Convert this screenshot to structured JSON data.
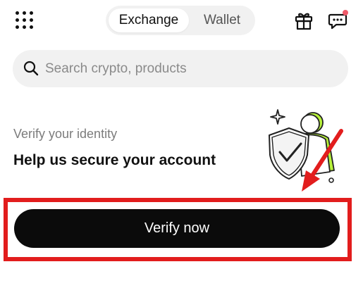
{
  "header": {
    "tabs": [
      {
        "label": "Exchange",
        "active": true
      },
      {
        "label": "Wallet",
        "active": false
      }
    ],
    "icons": {
      "menu": "grid-menu-icon",
      "gift": "gift-icon",
      "chat": "chat-icon"
    },
    "notification_dot_color": "#f05b6a"
  },
  "search": {
    "placeholder": "Search crypto, products",
    "value": ""
  },
  "verify_card": {
    "subtitle": "Verify your identity",
    "title": "Help us secure your account",
    "button_label": "Verify now",
    "illustration": "verified-user-shield-illustration",
    "accent_color": "#b7f23a"
  },
  "annotation": {
    "color": "#e21d1d"
  }
}
